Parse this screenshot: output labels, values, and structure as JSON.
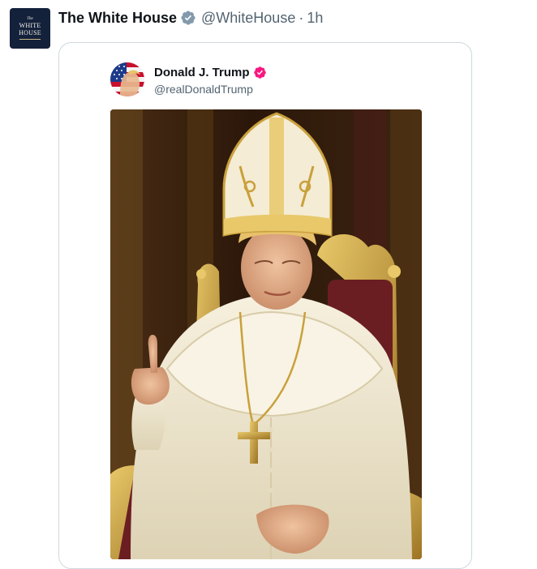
{
  "tweet": {
    "author": {
      "display_name": "The White House",
      "handle": "@WhiteHouse",
      "verified": "gray-verified-badge-icon",
      "avatar": {
        "line1": "The",
        "line2": "WHITE",
        "line3": "HOUSE",
        "bg_color": "#14213a"
      }
    },
    "separator": "·",
    "timestamp": "1h"
  },
  "quoted": {
    "author": {
      "display_name": "Donald J. Trump",
      "handle": "@realDonaldTrump",
      "verified": "pink-verified-badge-icon"
    },
    "media": {
      "type": "image",
      "subject": "papal-portrait-illustration",
      "colors": {
        "background": "#3a2412",
        "robe": "#f1ead6",
        "gold": "#c9a03c",
        "velvet": "#6b1e22"
      }
    }
  }
}
